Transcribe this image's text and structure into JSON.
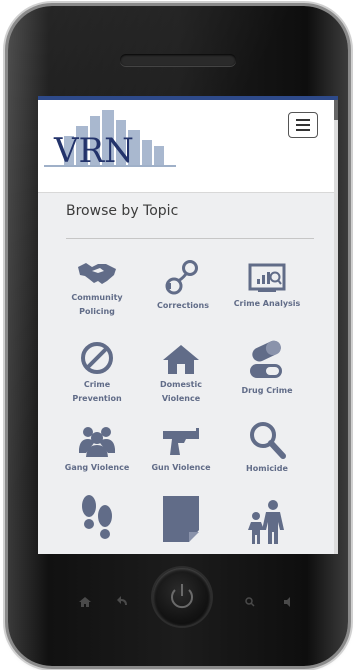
{
  "site": {
    "logo_text": "VRN"
  },
  "header": {
    "menu_icon": "hamburger-menu-icon"
  },
  "browse": {
    "title": "Browse by Topic"
  },
  "topics": [
    {
      "label_line1": "Community",
      "label_line2": "Policing",
      "icon": "handshake-icon"
    },
    {
      "label_line1": "Corrections",
      "label_line2": "",
      "icon": "handcuffs-icon"
    },
    {
      "label_line1": "Crime Analysis",
      "label_line2": "",
      "icon": "monitor-chart-icon"
    },
    {
      "label_line1": "Crime",
      "label_line2": "Prevention",
      "icon": "prohibited-icon"
    },
    {
      "label_line1": "Domestic",
      "label_line2": "Violence",
      "icon": "house-icon"
    },
    {
      "label_line1": "Drug Crime",
      "label_line2": "",
      "icon": "pills-icon"
    },
    {
      "label_line1": "Gang Violence",
      "label_line2": "",
      "icon": "group-icon"
    },
    {
      "label_line1": "Gun Violence",
      "label_line2": "",
      "icon": "gun-icon"
    },
    {
      "label_line1": "Homicide",
      "label_line2": "",
      "icon": "magnifier-icon"
    },
    {
      "label_line1": "",
      "label_line2": "",
      "icon": "footprints-icon"
    },
    {
      "label_line1": "",
      "label_line2": "",
      "icon": "document-icon"
    },
    {
      "label_line1": "",
      "label_line2": "",
      "icon": "family-icon"
    }
  ],
  "colors": {
    "icon": "#616c88",
    "header_bar": "#2e4a8a",
    "logo": "#23336b"
  }
}
